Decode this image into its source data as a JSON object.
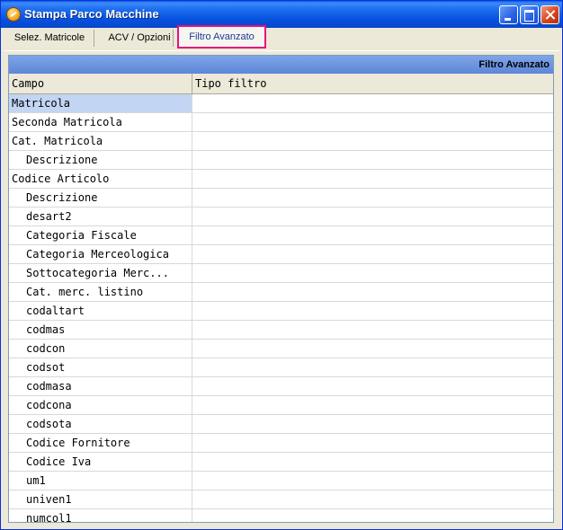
{
  "window": {
    "title": "Stampa Parco Macchine",
    "icon": "app-icon"
  },
  "tabs": [
    {
      "label": "Selez. Matricole",
      "active": false
    },
    {
      "label": "ACV / Opzioni",
      "active": false
    },
    {
      "label": "Filtro Avanzato",
      "active": true
    }
  ],
  "panel": {
    "caption": "Filtro Avanzato"
  },
  "grid": {
    "columns": [
      "Campo",
      "Tipo filtro"
    ],
    "rows": [
      {
        "campo": "Matricola",
        "tipo": "",
        "indent": false,
        "selected": true
      },
      {
        "campo": "Seconda Matricola",
        "tipo": "",
        "indent": false
      },
      {
        "campo": "Cat. Matricola",
        "tipo": "",
        "indent": false
      },
      {
        "campo": "Descrizione",
        "tipo": "",
        "indent": true
      },
      {
        "campo": "Codice Articolo",
        "tipo": "",
        "indent": false
      },
      {
        "campo": "Descrizione",
        "tipo": "",
        "indent": true
      },
      {
        "campo": "desart2",
        "tipo": "",
        "indent": true
      },
      {
        "campo": "Categoria Fiscale",
        "tipo": "",
        "indent": true
      },
      {
        "campo": "Categoria Merceologica",
        "tipo": "",
        "indent": true
      },
      {
        "campo": "Sottocategoria Merc...",
        "tipo": "",
        "indent": true
      },
      {
        "campo": "Cat. merc. listino",
        "tipo": "",
        "indent": true
      },
      {
        "campo": "codaltart",
        "tipo": "",
        "indent": true
      },
      {
        "campo": "codmas",
        "tipo": "",
        "indent": true
      },
      {
        "campo": "codcon",
        "tipo": "",
        "indent": true
      },
      {
        "campo": "codsot",
        "tipo": "",
        "indent": true
      },
      {
        "campo": "codmasa",
        "tipo": "",
        "indent": true
      },
      {
        "campo": "codcona",
        "tipo": "",
        "indent": true
      },
      {
        "campo": "codsota",
        "tipo": "",
        "indent": true
      },
      {
        "campo": "Codice Fornitore",
        "tipo": "",
        "indent": true
      },
      {
        "campo": "Codice Iva",
        "tipo": "",
        "indent": true
      },
      {
        "campo": "um1",
        "tipo": "",
        "indent": true
      },
      {
        "campo": "univen1",
        "tipo": "",
        "indent": true
      },
      {
        "campo": "numcol1",
        "tipo": "",
        "indent": true
      }
    ]
  },
  "colors": {
    "titlebar": "#0a5ee8",
    "highlight_tab_border": "#e4127e",
    "selected_row": "#c2d5f2",
    "caption": "#7fa5e8"
  }
}
